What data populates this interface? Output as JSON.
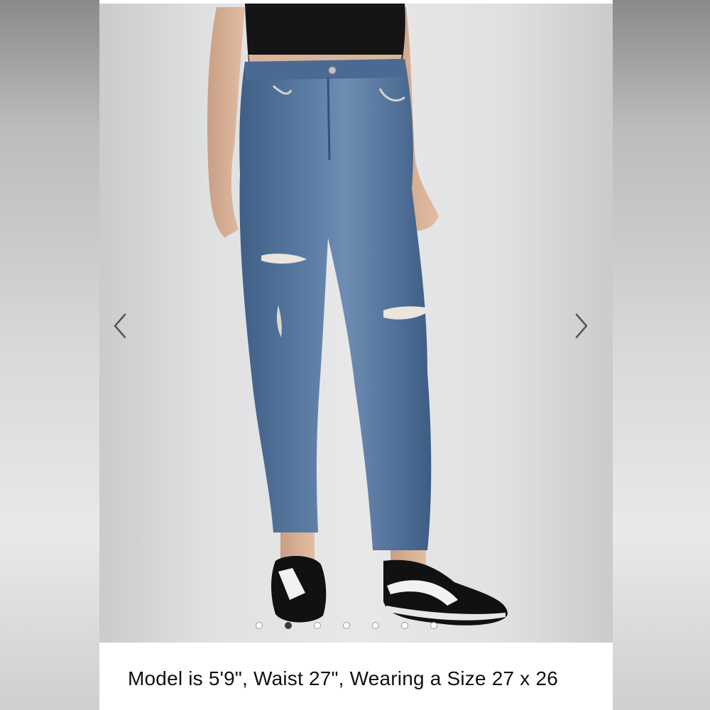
{
  "gallery": {
    "prev_icon": "chevron-left-icon",
    "next_icon": "chevron-right-icon",
    "slide_count": 7,
    "active_slide": 2,
    "image_subject": "blue-distressed-cropped-jeans-black-sneakers",
    "colors": {
      "denim": "#4d6e96",
      "top": "#151515",
      "background": "#e4e4e5",
      "dot_active": "#3b3b3b"
    }
  },
  "caption": {
    "text": "Model is 5'9\", Waist 27\", Wearing a Size 27 x 26"
  }
}
